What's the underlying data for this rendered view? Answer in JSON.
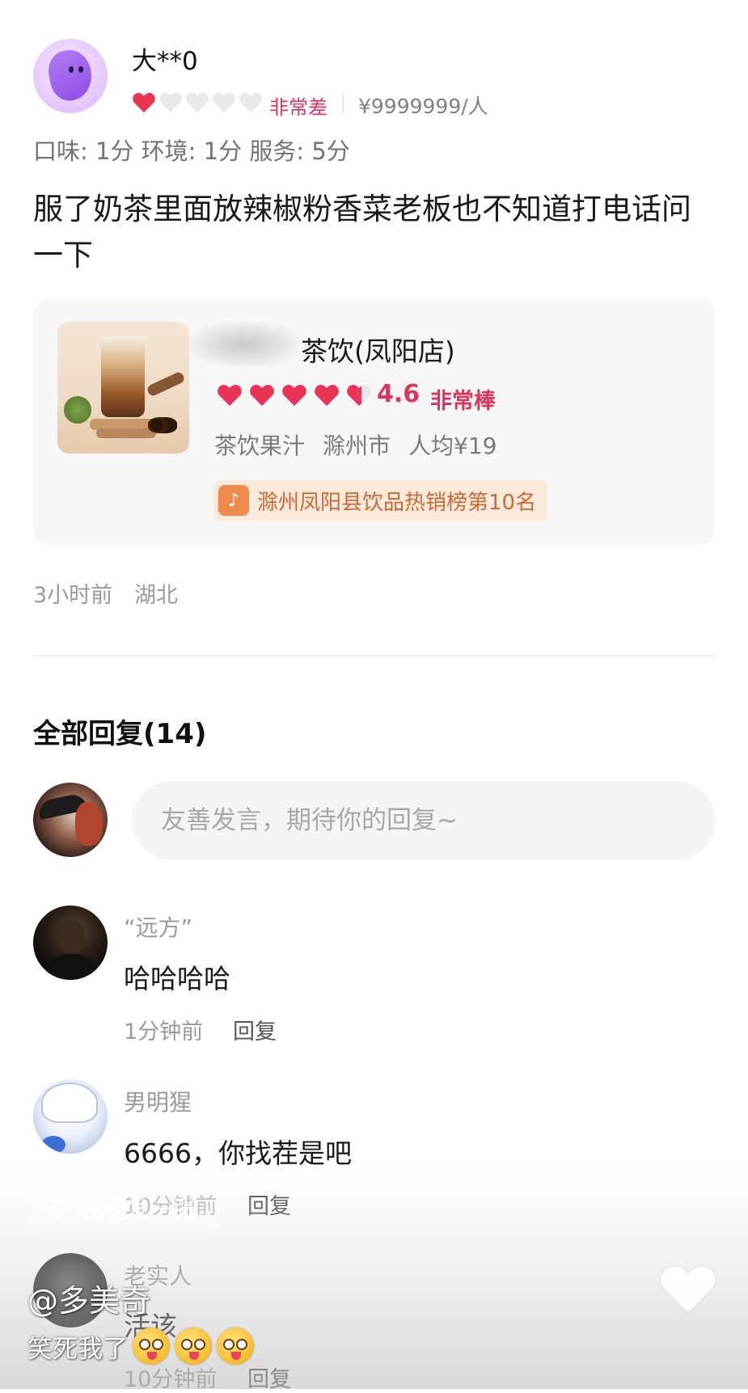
{
  "review": {
    "username": "大**0",
    "rating_text": "非常差",
    "price": "¥9999999/人",
    "scores": "口味: 1分  环境: 1分  服务: 5分",
    "body": "服了奶茶里面放辣椒粉香菜老板也不知道打电话问一下",
    "stars_filled": 1,
    "stars_total": 5,
    "time": "3小时前",
    "location": "湖北"
  },
  "shop": {
    "name": "茶饮(凤阳店)",
    "rating": "4.6",
    "rating_text": "非常棒",
    "category": "茶饮果汁",
    "city": "滁州市",
    "avg_price": "人均¥19",
    "rank_badge": "滁州凤阳县饮品热销榜第10名"
  },
  "replies": {
    "header": "全部回复(14)",
    "input_placeholder": "友善发言，期待你的回复~",
    "reply_label": "回复",
    "comments": [
      {
        "name": "“远方”",
        "text": "哈哈哈哈",
        "time": "1分钟前"
      },
      {
        "name": "男明猩",
        "text": "6666，你找茬是吧",
        "time": "10分钟前"
      },
      {
        "name": "老实人",
        "text": "活该",
        "time": "10分钟前"
      }
    ]
  },
  "overlay": {
    "post_button": "我也发一张",
    "watermark": "@多美奇",
    "caption": "笑死我了"
  },
  "colors": {
    "rating_red": "#d8365e",
    "heart_empty": "#e6e6e6",
    "badge_bg": "#fbe9dc",
    "badge_text": "#c86a35",
    "card_bg": "#f7f7f7"
  },
  "icons": {
    "rating": "heart-icon",
    "badge": "douyin-icon",
    "like": "heart-icon",
    "add": "plus-icon"
  }
}
